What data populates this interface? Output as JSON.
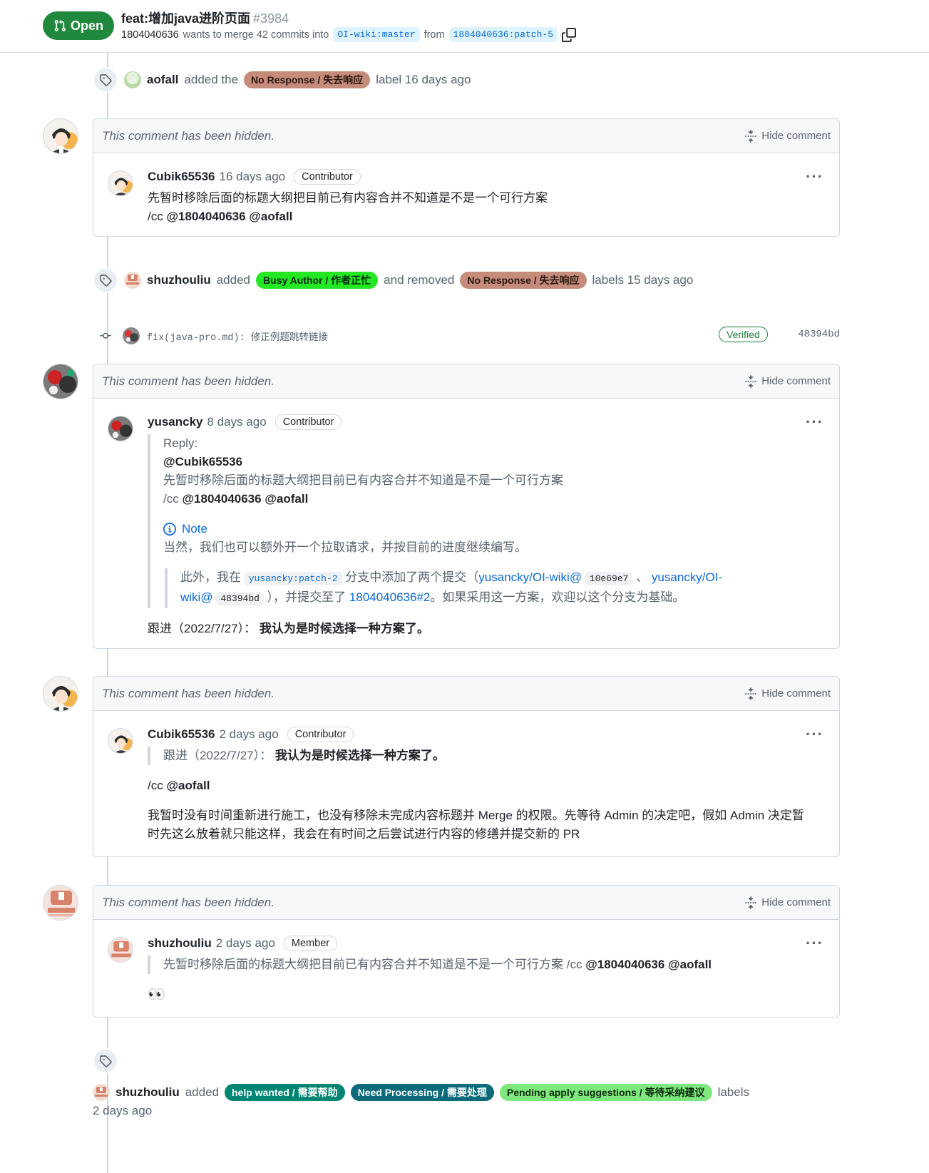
{
  "header": {
    "status": "Open",
    "title": "feat:增加java进阶页面",
    "number": "#3984",
    "author": "1804040636",
    "merge_text": "wants to merge 42 commits into",
    "base_branch": "OI-wiki:master",
    "from_text": "from",
    "head_branch": "1804040636:patch-5"
  },
  "events": {
    "e1": {
      "actor": "aofall",
      "verb": "added the",
      "label": "No Response / 失去响应",
      "suffix": "label 16 days ago"
    },
    "e2": {
      "actor": "shuzhouliu",
      "verb": "added",
      "added_label": "Busy Author / 作者正忙",
      "middle": "and removed",
      "removed_label": "No Response / 失去响应",
      "suffix": "labels 15 days ago"
    },
    "commit": {
      "message": "fix(java-pro.md): 修正例题跳转链接",
      "verified": "Verified",
      "sha": "48394bd"
    },
    "e3": {
      "actor": "shuzhouliu",
      "verb": "added",
      "labels": [
        "help wanted / 需要帮助",
        "Need Processing / 需要处理",
        "Pending apply suggestions / 等待采纳建议"
      ],
      "suffix": "labels",
      "time": "2 days ago"
    }
  },
  "hidden_text": "This comment has been hidden.",
  "hide_label": "Hide comment",
  "more": "···",
  "comments": [
    {
      "author": "Cubik65536",
      "time": "16 days ago",
      "role": "Contributor",
      "line1": "先暂时移除后面的标题大纲把目前已有内容合并不知道是不是一个可行方案",
      "line2_prefix": "/cc",
      "mentions": "@1804040636 @aofall"
    },
    {
      "author": "yusancky",
      "time": "8 days ago",
      "role": "Contributor",
      "reply_label": "Reply:",
      "reply_mention": "@Cubik65536",
      "reply_line": "先暂时移除后面的标题大纲把目前已有内容合并不知道是不是一个可行方案",
      "reply_cc": "/cc",
      "reply_cc_mentions": "@1804040636 @aofall",
      "note_title": "Note",
      "note_text": "当然，我们也可以额外开一个拉取请求，并按目前的进度继续编写。",
      "inner_a": "此外，我在",
      "inner_branch": "yusancky:patch-2",
      "inner_b": "分支中添加了两个提交（",
      "inner_link1": "yusancky/OI-wiki@",
      "inner_sha1": "10e69e7",
      "inner_sep": "、",
      "inner_link2a": "yusancky/OI-",
      "inner_link2b": "wiki@",
      "inner_sha2": "48394bd",
      "inner_c": "），并提交至了",
      "inner_pr": "1804040636#2",
      "inner_d": "。如果采用这一方案，欢迎以这个分支为基础。",
      "followup_prefix": "跟进（2022/7/27）：",
      "followup_bold": "我认为是时候选择一种方案了。"
    },
    {
      "author": "Cubik65536",
      "time": "2 days ago",
      "role": "Contributor",
      "quote_prefix": "跟进（2022/7/27）：",
      "quote_bold": "我认为是时候选择一种方案了。",
      "cc_prefix": "/cc",
      "cc_mention": "@aofall",
      "para_line1": "我暂时没有时间重新进行施工，也没有移除未完成内容标题并 Merge 的权限。先等待 Admin 的决定吧，假如 Admin 决定暂",
      "para_line2": "时先这么放着就只能这样，我会在有时间之后尝试进行内容的修缮并提交新的 PR"
    },
    {
      "author": "shuzhouliu",
      "time": "2 days ago",
      "role": "Member",
      "quote_text": "先暂时移除后面的标题大纲把目前已有内容合并不知道是不是一个可行方案 /cc",
      "quote_mentions": "@1804040636 @aofall",
      "emoji": "👀"
    }
  ],
  "colors": {
    "open_green": "#1f883d",
    "no_response_label": "#c58b7b",
    "busy_author_label": "#23e823",
    "help_wanted_label": "#008672",
    "need_processing_label": "#0b6b7a",
    "pending_label": "#7ee87e"
  }
}
